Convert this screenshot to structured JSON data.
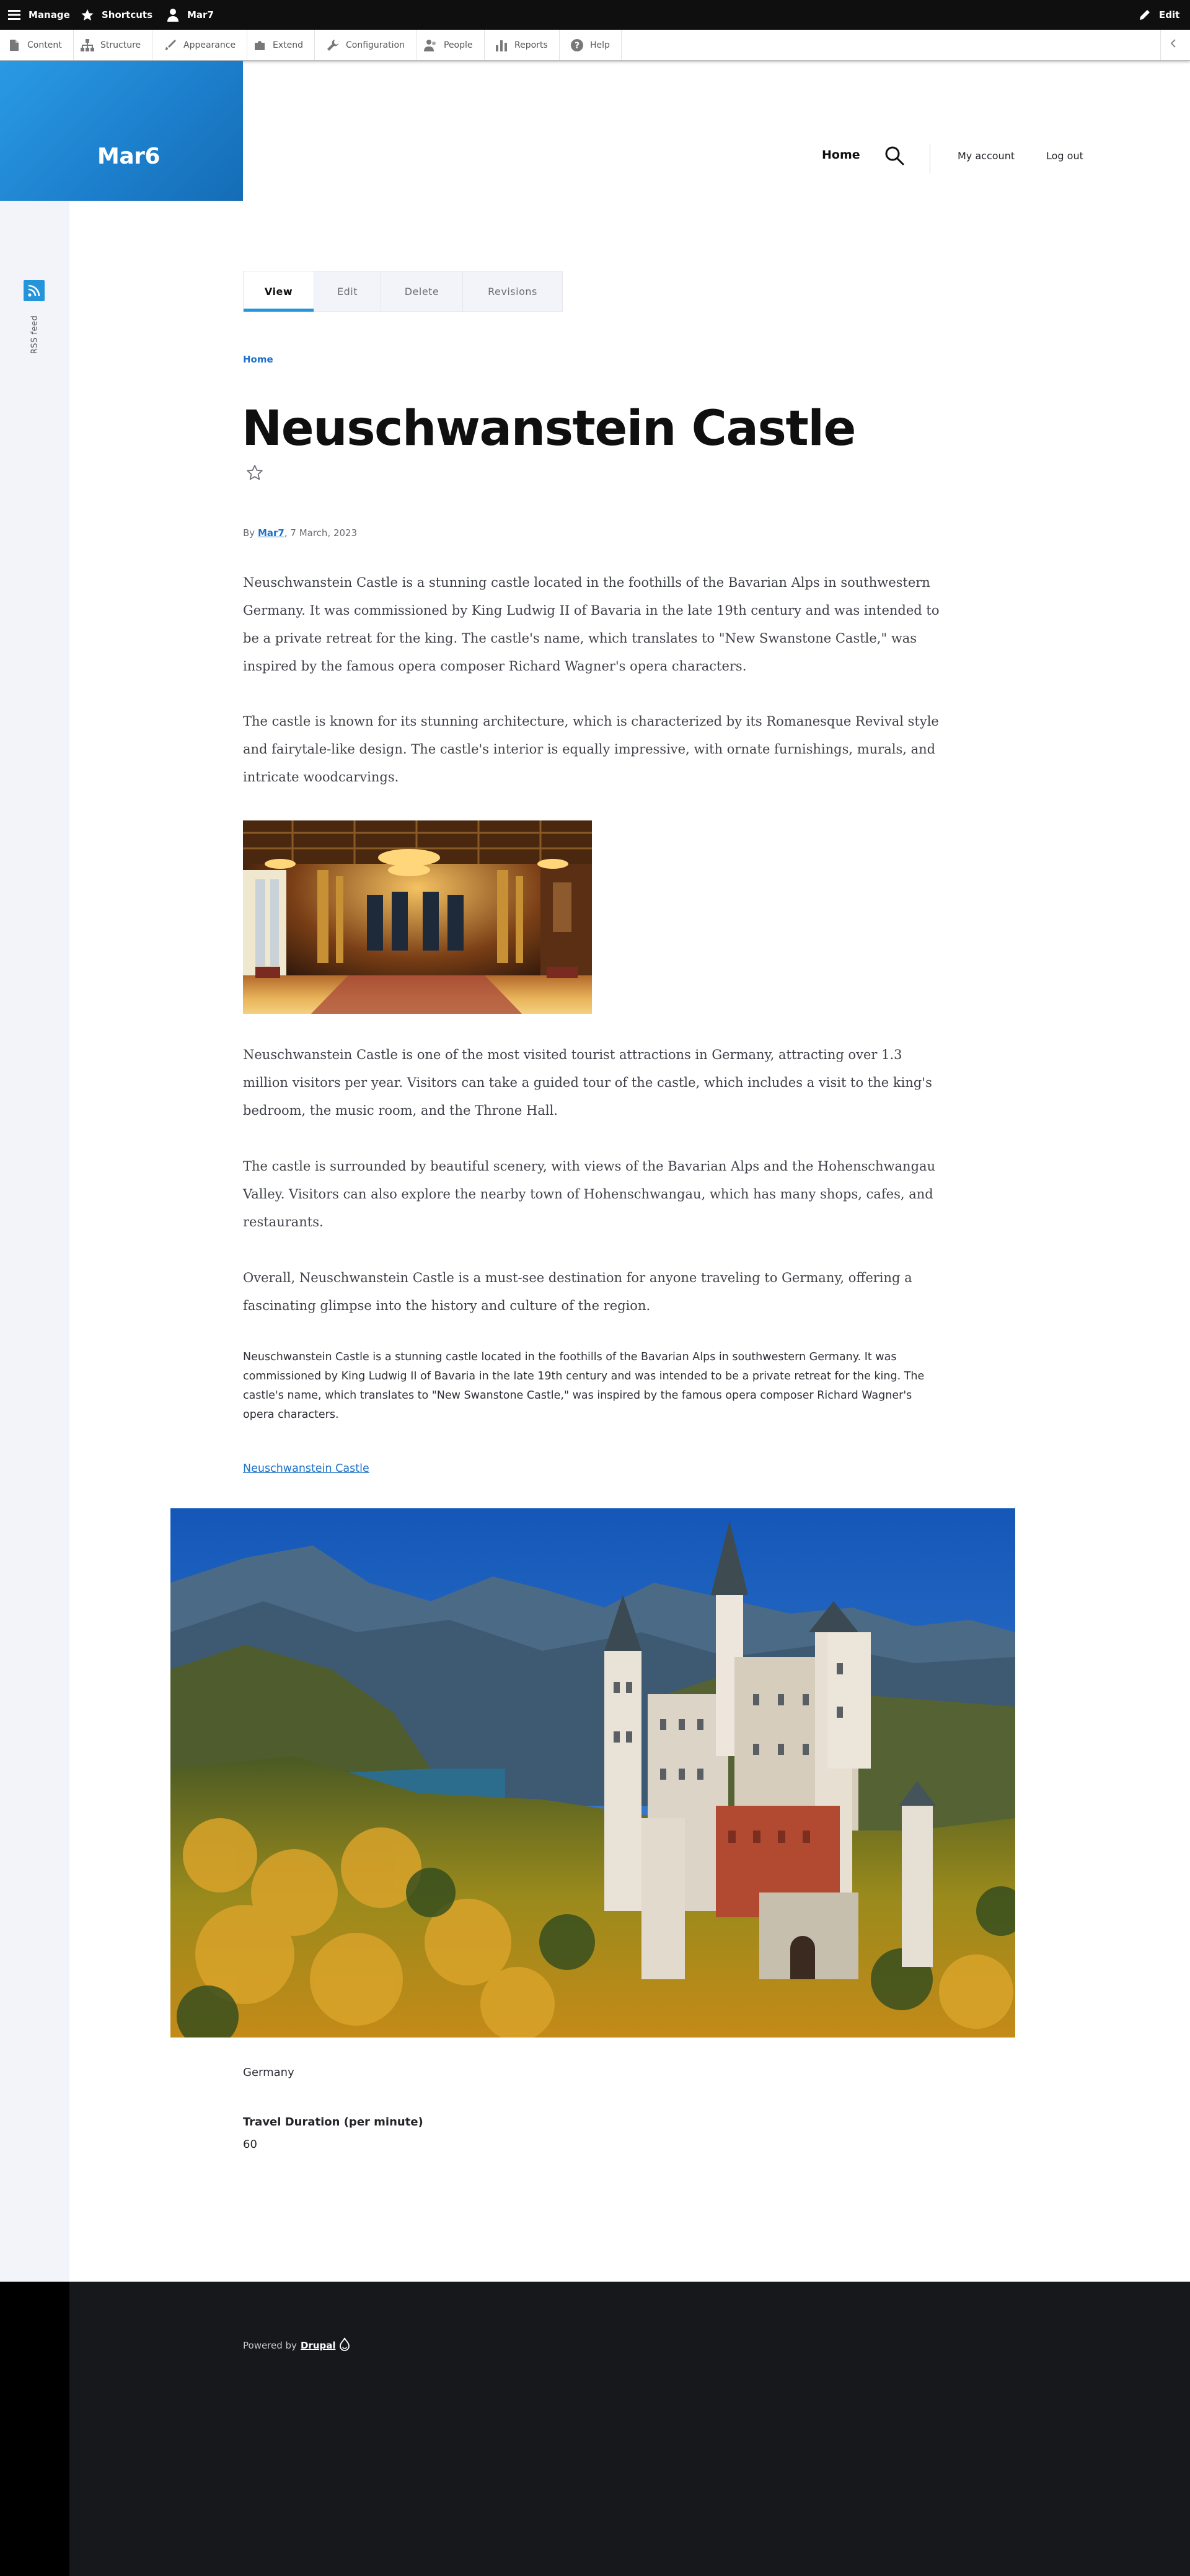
{
  "toolbar": {
    "manage": "Manage",
    "shortcuts": "Shortcuts",
    "user": "Mar7",
    "edit": "Edit",
    "tray": [
      "Content",
      "Structure",
      "Appearance",
      "Extend",
      "Configuration",
      "People",
      "Reports",
      "Help"
    ]
  },
  "site": {
    "name": "Mar6"
  },
  "nav": {
    "home": "Home",
    "account": "My account",
    "logout": "Log out"
  },
  "sidebar": {
    "rss": "RSS feed"
  },
  "tabs": [
    "View",
    "Edit",
    "Delete",
    "Revisions"
  ],
  "breadcrumb": "Home",
  "article": {
    "title": "Neuschwanstein Castle",
    "byline_prefix": "By",
    "author": "Mar7",
    "date": ", 7 March, 2023",
    "paragraphs": [
      "Neuschwanstein Castle is a stunning castle located in the foothills of the Bavarian Alps in southwestern Germany. It was commissioned by King Ludwig II of Bavaria in the late 19th century and was intended to be a private retreat for the king. The castle's name, which translates to \"New Swanstone Castle,\" was inspired by the famous opera composer Richard Wagner's opera characters.",
      "The castle is known for its stunning architecture, which is characterized by its Romanesque Revival style and fairytale-like design. The castle's interior is equally impressive, with ornate furnishings, murals, and intricate woodcarvings.",
      "Neuschwanstein Castle is one of the most visited tourist attractions in Germany, attracting over 1.3 million visitors per year. Visitors can take a guided tour of the castle, which includes a visit to the king's bedroom, the music room, and the Throne Hall.",
      "The castle is surrounded by beautiful scenery, with views of the Bavarian Alps and the Hohenschwangau Valley. Visitors can also explore the nearby town of Hohenschwangau, which has many shops, cafes, and restaurants.",
      "Overall, Neuschwanstein Castle is a must-see destination for anyone traveling to Germany, offering a fascinating glimpse into the history and culture of the region."
    ],
    "summary": "Neuschwanstein Castle is a stunning castle located in the foothills of the Bavarian Alps in southwestern Germany. It was commissioned by King Ludwig II of Bavaria in the late 19th century and was intended to be a private retreat for the king. The castle's name, which translates to \"New Swanstone Castle,\" was inspired by the famous opera composer Richard Wagner's opera characters.",
    "link": "Neuschwanstein Castle",
    "country": "Germany",
    "travel_label": "Travel Duration (per minute)",
    "travel_value": "60"
  },
  "footer": {
    "powered_by": "Powered by",
    "drupal": "Drupal"
  },
  "colors": {
    "accent": "#2494db",
    "link": "#1d72c9",
    "footer": "#16181b",
    "toolbar": "#0f0f0f"
  }
}
